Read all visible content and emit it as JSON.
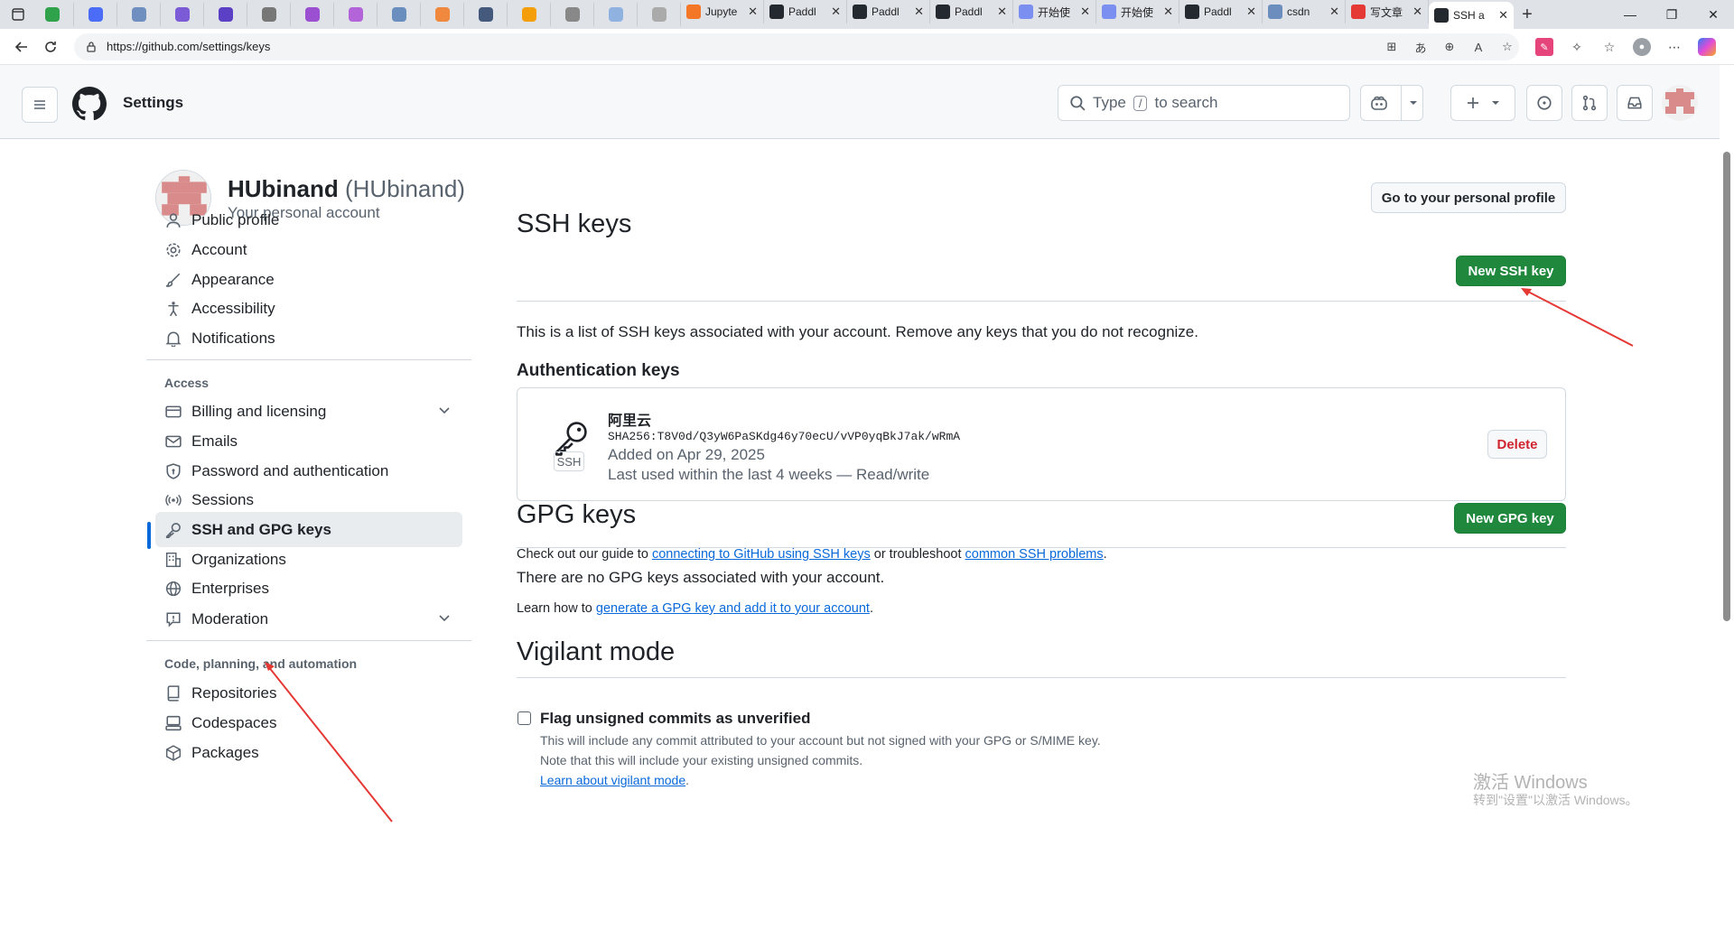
{
  "browser": {
    "pinned_tab_colors": [
      "#31a24c",
      "#4a6cf7",
      "#6e8fbf",
      "#7b5cd6",
      "#5b3fc4",
      "#777777",
      "#9b4fd1",
      "#b464d9",
      "#6a8fbf",
      "#f0883e",
      "#44597b",
      "#f59e0b",
      "#888888",
      "#8fb2e0",
      "#aaaaaa"
    ],
    "tabs": [
      {
        "title": "Jupyte",
        "fav_color": "#f37726"
      },
      {
        "title": "Paddl",
        "fav_color": "#24292f"
      },
      {
        "title": "Paddl",
        "fav_color": "#24292f"
      },
      {
        "title": "Paddl",
        "fav_color": "#24292f"
      },
      {
        "title": "开始使",
        "fav_color": "#7a8ff0"
      },
      {
        "title": "开始使",
        "fav_color": "#7a8ff0"
      },
      {
        "title": "Paddl",
        "fav_color": "#24292f"
      },
      {
        "title": "csdn",
        "fav_color": "#6c8ebf"
      },
      {
        "title": "写文章",
        "fav_color": "#e53935"
      },
      {
        "title": "SSH a",
        "fav_color": "#24292f",
        "active": true
      }
    ],
    "url": "https://github.com/settings/keys"
  },
  "header": {
    "title": "Settings",
    "search_prefix": "Type",
    "search_key": "/",
    "search_suffix": "to search"
  },
  "profile": {
    "name": "HUbinand",
    "login": "(HUbinand)",
    "subtitle": "Your personal account",
    "profile_button": "Go to your personal profile"
  },
  "sidebar": {
    "items_top": [
      "Public profile",
      "Account",
      "Appearance",
      "Accessibility",
      "Notifications"
    ],
    "access_heading": "Access",
    "access_items": [
      "Billing and licensing",
      "Emails",
      "Password and authentication",
      "Sessions",
      "SSH and GPG keys",
      "Organizations",
      "Enterprises",
      "Moderation"
    ],
    "code_heading": "Code, planning, and automation",
    "code_items": [
      "Repositories",
      "Codespaces",
      "Packages"
    ]
  },
  "ssh": {
    "title": "SSH keys",
    "new_button": "New SSH key",
    "description": "This is a list of SSH keys associated with your account. Remove any keys that you do not recognize.",
    "auth_heading": "Authentication keys",
    "key": {
      "label": "SSH",
      "title": "阿里云",
      "fingerprint": "SHA256:T8V0d/Q3yW6PaSKdg46y70ecU/vVP0yqBkJ7ak/wRmA",
      "added": "Added on Apr 29, 2025",
      "last_used": "Last used within the last 4 weeks — Read/write",
      "delete_button": "Delete"
    },
    "guide_prefix": "Check out our guide to",
    "guide_link1": "connecting to GitHub using SSH keys",
    "guide_mid": "or troubleshoot",
    "guide_link2": "common SSH problems",
    "guide_end": "."
  },
  "gpg": {
    "title": "GPG keys",
    "new_button": "New GPG key",
    "empty": "There are no GPG keys associated with your account.",
    "learn_prefix": "Learn how to",
    "learn_link": "generate a GPG key and add it to your account",
    "learn_end": "."
  },
  "vigilant": {
    "title": "Vigilant mode",
    "checkbox_label": "Flag unsigned commits as unverified",
    "note1": "This will include any commit attributed to your account but not signed with your GPG or S/MIME key.",
    "note2": "Note that this will include your existing unsigned commits.",
    "learn_link": "Learn about vigilant mode",
    "learn_end": "."
  },
  "watermark": {
    "line1": "激活 Windows",
    "line2": "转到\"设置\"以激活 Windows。"
  },
  "colors": {
    "primary": "#1f883d",
    "link": "#0969da",
    "danger": "#d1242f",
    "annotation": "#e53935"
  }
}
